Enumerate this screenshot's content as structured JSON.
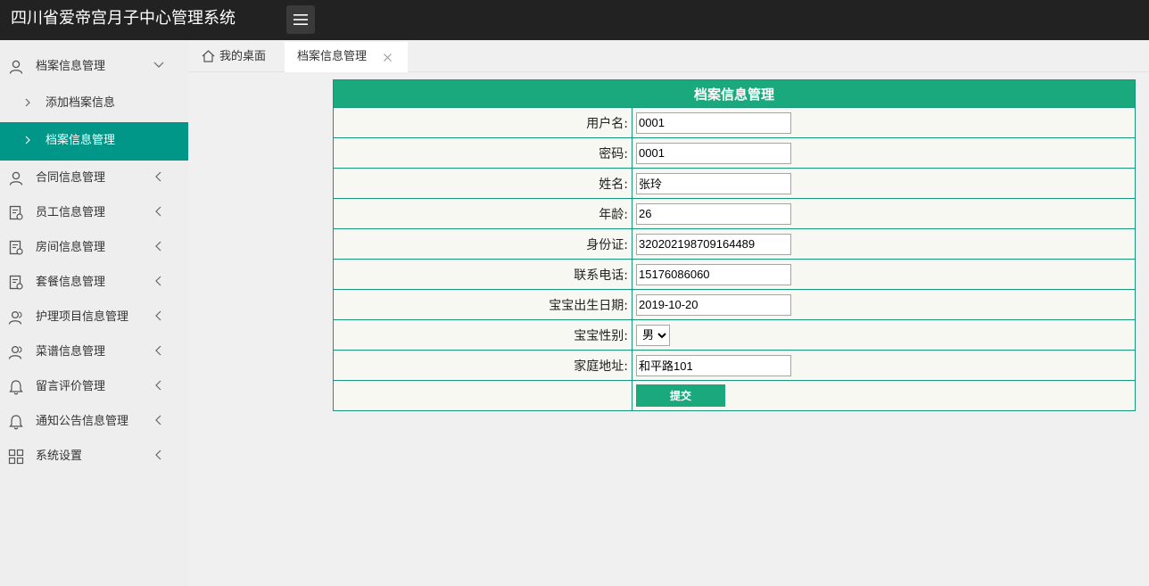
{
  "app": {
    "title": "四川省爱帝宫月子中心管理系统"
  },
  "sidebar": {
    "items": [
      {
        "label": "档案信息管理",
        "icon": "user-icon",
        "expanded": true
      },
      {
        "label": "合同信息管理",
        "icon": "user-icon"
      },
      {
        "label": "员工信息管理",
        "icon": "document-icon"
      },
      {
        "label": "房间信息管理",
        "icon": "document-icon"
      },
      {
        "label": "套餐信息管理",
        "icon": "document-icon"
      },
      {
        "label": "护理项目信息管理",
        "icon": "users-icon"
      },
      {
        "label": "菜谱信息管理",
        "icon": "users-icon"
      },
      {
        "label": "留言评价管理",
        "icon": "bell-icon"
      },
      {
        "label": "通知公告信息管理",
        "icon": "bell-icon"
      },
      {
        "label": "系统设置",
        "icon": "grid-icon"
      }
    ],
    "subitems": [
      {
        "label": "添加档案信息"
      },
      {
        "label": "档案信息管理",
        "active": true
      }
    ]
  },
  "tabs": [
    {
      "label": "我的桌面",
      "icon": "home-icon"
    },
    {
      "label": "档案信息管理",
      "closable": true
    }
  ],
  "form": {
    "title": "档案信息管理",
    "fields": [
      {
        "label": "用户名:",
        "value": "0001"
      },
      {
        "label": "密码:",
        "value": "0001"
      },
      {
        "label": "姓名:",
        "value": "张玲"
      },
      {
        "label": "年龄:",
        "value": "26"
      },
      {
        "label": "身份证:",
        "value": "320202198709164489"
      },
      {
        "label": "联系电话:",
        "value": "15176086060"
      },
      {
        "label": "宝宝出生日期:",
        "value": "2019-10-20"
      },
      {
        "label": "宝宝性别:",
        "value": "男",
        "type": "select"
      },
      {
        "label": "家庭地址:",
        "value": "和平路101"
      }
    ],
    "submit_label": "提交"
  },
  "colors": {
    "topbar": "#222222",
    "accent": "#009688",
    "form_header": "#1aa97c",
    "form_border": "#19967a",
    "form_cell": "#f8f8f2"
  }
}
